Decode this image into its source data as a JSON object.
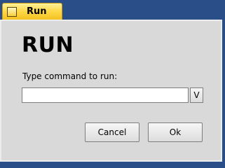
{
  "window": {
    "title": "Run",
    "icon": "window-icon"
  },
  "dialog": {
    "heading": "RUN",
    "prompt": "Type command to run:",
    "command_value": "",
    "dropdown_label": "V",
    "cancel_label": "Cancel",
    "ok_label": "Ok"
  },
  "colors": {
    "desktop": "#2a4e88",
    "title_tab": "#ffd94a",
    "dialog_bg": "#d9d9d9"
  }
}
